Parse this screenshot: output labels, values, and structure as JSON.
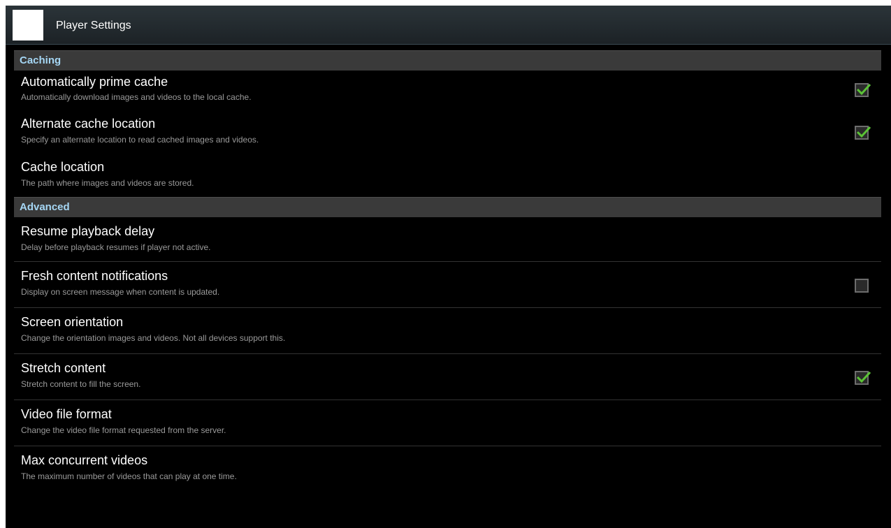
{
  "actionbar": {
    "title": "Player Settings",
    "icon": "app-icon"
  },
  "colors": {
    "category_text": "#a5d6f4",
    "checkbox_checked": "#5bc236"
  },
  "categories": [
    {
      "label": "Caching",
      "items": [
        {
          "title": "Automatically prime cache",
          "summary": "Automatically download images and videos to the local cache.",
          "checkbox": true,
          "checked": true
        },
        {
          "title": "Alternate cache location",
          "summary": "Specify an alternate location to read cached images and videos.",
          "checkbox": true,
          "checked": true
        },
        {
          "title": "Cache location",
          "summary": "The path where images and videos are stored.",
          "checkbox": false
        }
      ]
    },
    {
      "label": "Advanced",
      "items": [
        {
          "title": "Resume playback delay",
          "summary": "Delay before playback resumes if player not active.",
          "checkbox": false
        },
        {
          "title": "Fresh content notifications",
          "summary": "Display on screen message when content is updated.",
          "checkbox": true,
          "checked": false
        },
        {
          "title": "Screen orientation",
          "summary": "Change the orientation images and videos. Not all devices support this.",
          "checkbox": false
        },
        {
          "title": "Stretch content",
          "summary": "Stretch content to fill the screen.",
          "checkbox": true,
          "checked": true
        },
        {
          "title": "Video file format",
          "summary": "Change the video file format requested from the server.",
          "checkbox": false
        },
        {
          "title": "Max concurrent videos",
          "summary": "The maximum number of videos that can play at one time.",
          "checkbox": false
        }
      ]
    }
  ]
}
